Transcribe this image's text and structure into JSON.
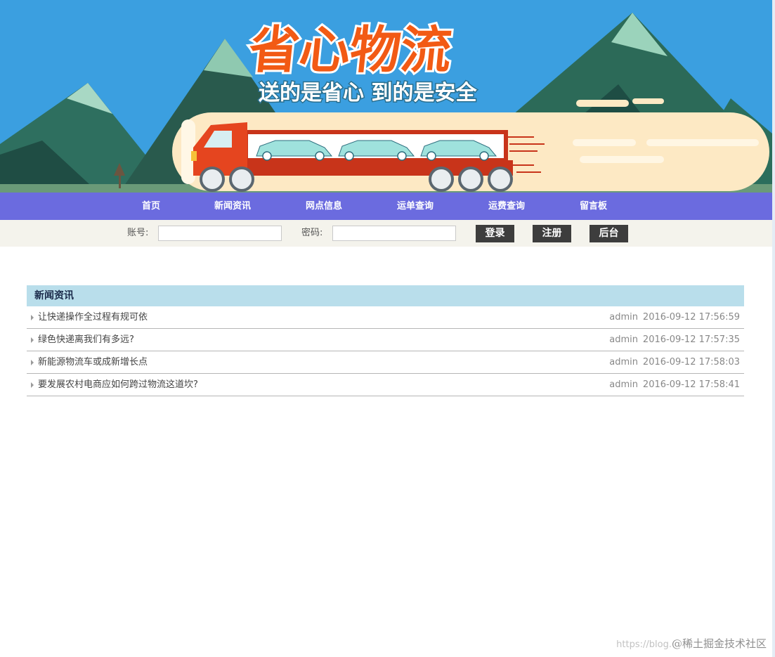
{
  "banner": {
    "title": "省心物流",
    "slogan": "送的是省心 到的是安全"
  },
  "nav": {
    "items": [
      {
        "label": "首页"
      },
      {
        "label": "新闻资讯"
      },
      {
        "label": "网点信息"
      },
      {
        "label": "运单查询"
      },
      {
        "label": "运费查询"
      },
      {
        "label": "留言板"
      }
    ]
  },
  "login": {
    "account_label": "账号:",
    "account_value": "",
    "password_label": "密码:",
    "password_value": "",
    "login_button": "登录",
    "register_button": "注册",
    "admin_button": "后台"
  },
  "news": {
    "heading": "新闻资讯",
    "rows": [
      {
        "title": "让快递操作全过程有规可依",
        "author": "admin",
        "date": "2016-09-12 17:56:59"
      },
      {
        "title": "绿色快递离我们有多远?",
        "author": "admin",
        "date": "2016-09-12 17:57:35"
      },
      {
        "title": "新能源物流车或成新增长点",
        "author": "admin",
        "date": "2016-09-12 17:58:03"
      },
      {
        "title": "要发展农村电商应如何跨过物流这道坎?",
        "author": "admin",
        "date": "2016-09-12 17:58:41"
      }
    ]
  },
  "watermark": {
    "prefix": "https://blog.",
    "site": "@稀土掘金技术社区"
  },
  "colors": {
    "nav_bg": "#6b6bdf",
    "login_bar_bg": "#f4f3ec",
    "news_head_bg": "#b9deeb",
    "button_bg": "#3d3d3d",
    "sky": "#3b9fe0"
  }
}
